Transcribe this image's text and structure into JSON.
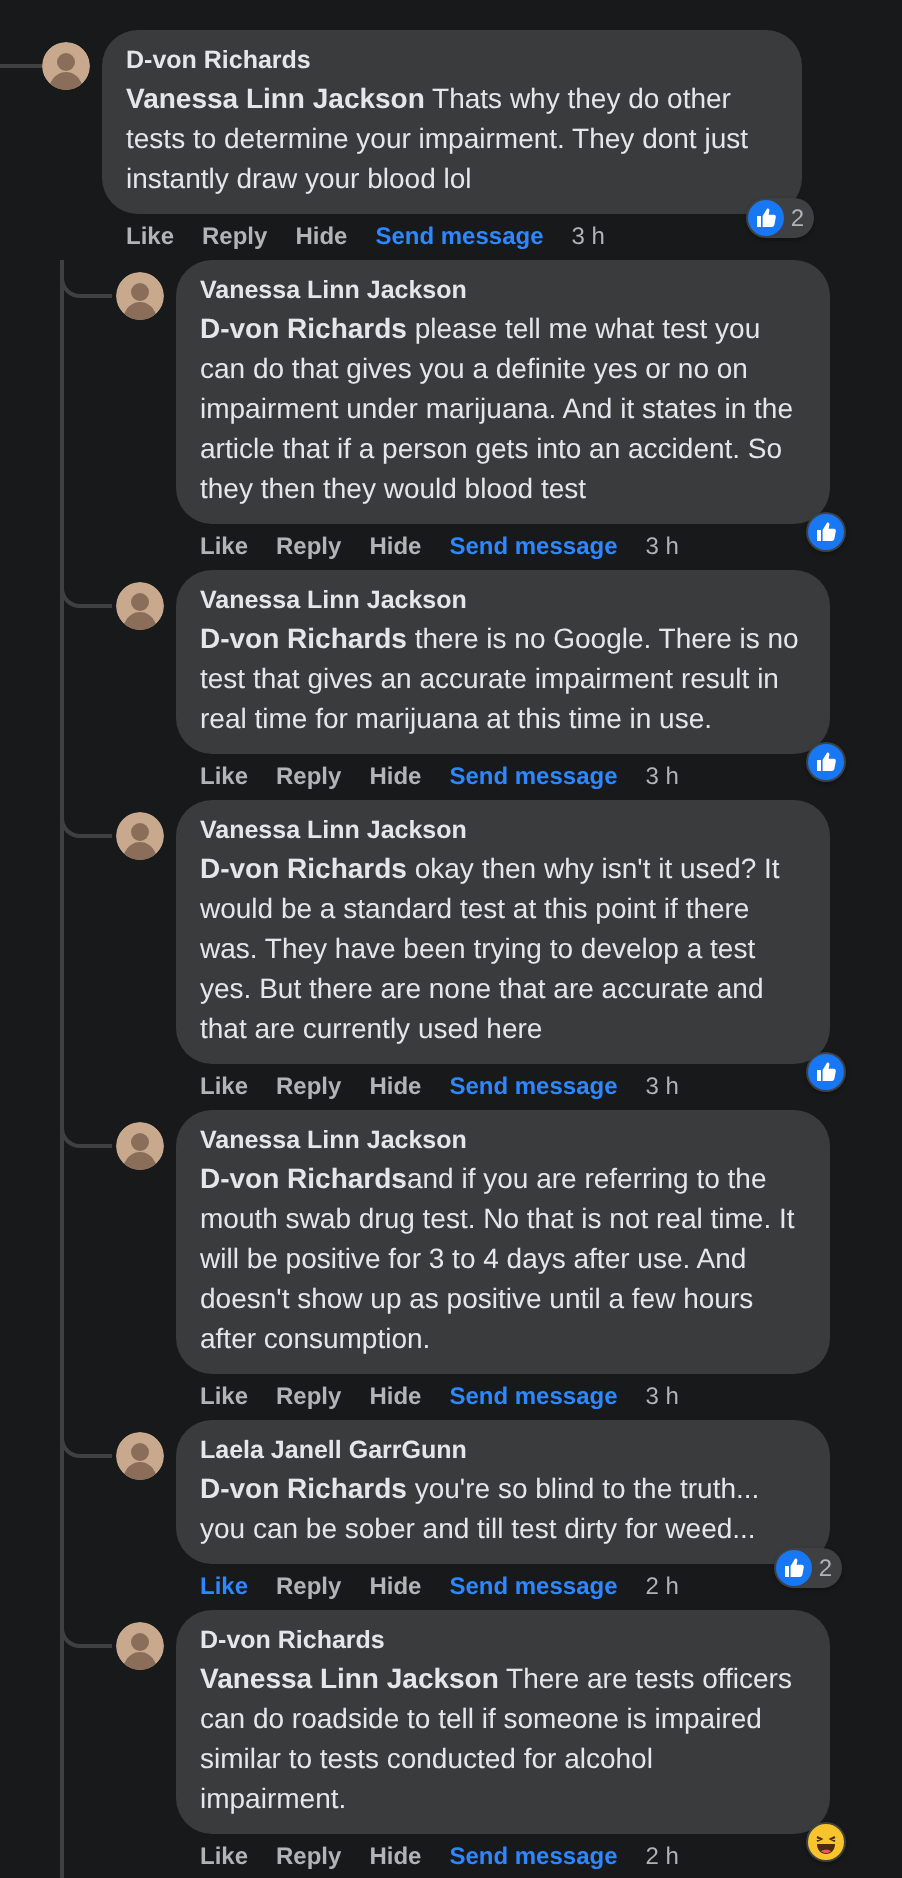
{
  "comment": {
    "author": "D-von Richards",
    "body": "**Vanessa Linn Jackson** Thats why they do other tests to determine your impairment. They dont just instantly draw your blood lol",
    "liked": false,
    "actions": [
      {
        "label": "Like",
        "kind": "like"
      },
      {
        "label": "Reply",
        "kind": "plain"
      },
      {
        "label": "Hide",
        "kind": "plain"
      },
      {
        "label": "Send message",
        "kind": "link"
      },
      {
        "label": "3 h",
        "kind": "time"
      }
    ],
    "reactions": {
      "icons": [
        {
          "kind": "like"
        }
      ],
      "count": "2"
    },
    "children": [
      {
        "author": "Vanessa Linn Jackson",
        "body": "**D-von Richards** please tell me what test you can do that gives you a definite yes or no on impairment under marijuana. And it states in the article that if a person gets into an accident. So they then they would blood test",
        "liked": false,
        "actions": [
          {
            "label": "Like",
            "kind": "like"
          },
          {
            "label": "Reply",
            "kind": "plain"
          },
          {
            "label": "Hide",
            "kind": "plain"
          },
          {
            "label": "Send message",
            "kind": "link"
          },
          {
            "label": "3 h",
            "kind": "time"
          }
        ],
        "reactions": {
          "icons": [
            {
              "kind": "like"
            }
          ]
        }
      },
      {
        "author": "Vanessa Linn Jackson",
        "body": "**D-von Richards** there is no Google. There is no test that gives an accurate impairment result in real time for marijuana at this time in use.",
        "liked": false,
        "actions": [
          {
            "label": "Like",
            "kind": "like"
          },
          {
            "label": "Reply",
            "kind": "plain"
          },
          {
            "label": "Hide",
            "kind": "plain"
          },
          {
            "label": "Send message",
            "kind": "link"
          },
          {
            "label": "3 h",
            "kind": "time"
          }
        ],
        "reactions": {
          "icons": [
            {
              "kind": "like"
            }
          ]
        }
      },
      {
        "author": "Vanessa Linn Jackson",
        "body": "**D-von Richards** okay then why isn't it used? It would be a standard test at this point if there was. They have been trying to develop a test yes. But there are none that are accurate and that are currently used here",
        "liked": false,
        "actions": [
          {
            "label": "Like",
            "kind": "like"
          },
          {
            "label": "Reply",
            "kind": "plain"
          },
          {
            "label": "Hide",
            "kind": "plain"
          },
          {
            "label": "Send message",
            "kind": "link"
          },
          {
            "label": "3 h",
            "kind": "time"
          }
        ],
        "reactions": {
          "icons": [
            {
              "kind": "like"
            }
          ]
        }
      },
      {
        "author": "Vanessa Linn Jackson",
        "body": "**D-von Richards**and if you are referring to the mouth swab drug test. No that is not real time. It will be positive for 3 to 4 days after use. And doesn't show up as positive until a few hours after consumption.",
        "liked": false,
        "actions": [
          {
            "label": "Like",
            "kind": "like"
          },
          {
            "label": "Reply",
            "kind": "plain"
          },
          {
            "label": "Hide",
            "kind": "plain"
          },
          {
            "label": "Send message",
            "kind": "link"
          },
          {
            "label": "3 h",
            "kind": "time"
          }
        ]
      },
      {
        "author": "Laela Janell GarrGunn",
        "body": "**D-von Richards** you're so blind to the truth... you can be sober and till test dirty for weed...",
        "liked": true,
        "actions": [
          {
            "label": "Like",
            "kind": "like"
          },
          {
            "label": "Reply",
            "kind": "plain"
          },
          {
            "label": "Hide",
            "kind": "plain"
          },
          {
            "label": "Send message",
            "kind": "link"
          },
          {
            "label": "2 h",
            "kind": "time"
          }
        ],
        "reactions": {
          "icons": [
            {
              "kind": "like"
            }
          ],
          "count": "2"
        }
      },
      {
        "author": "D-von Richards",
        "body": "**Vanessa Linn Jackson** There are tests officers can do roadside to tell if someone is impaired similar to tests conducted for alcohol impairment.",
        "liked": false,
        "actions": [
          {
            "label": "Like",
            "kind": "like"
          },
          {
            "label": "Reply",
            "kind": "plain"
          },
          {
            "label": "Hide",
            "kind": "plain"
          },
          {
            "label": "Send message",
            "kind": "link"
          },
          {
            "label": "2 h",
            "kind": "time"
          }
        ],
        "reactions": {
          "icons": [
            {
              "kind": "haha"
            }
          ]
        }
      }
    ]
  }
}
